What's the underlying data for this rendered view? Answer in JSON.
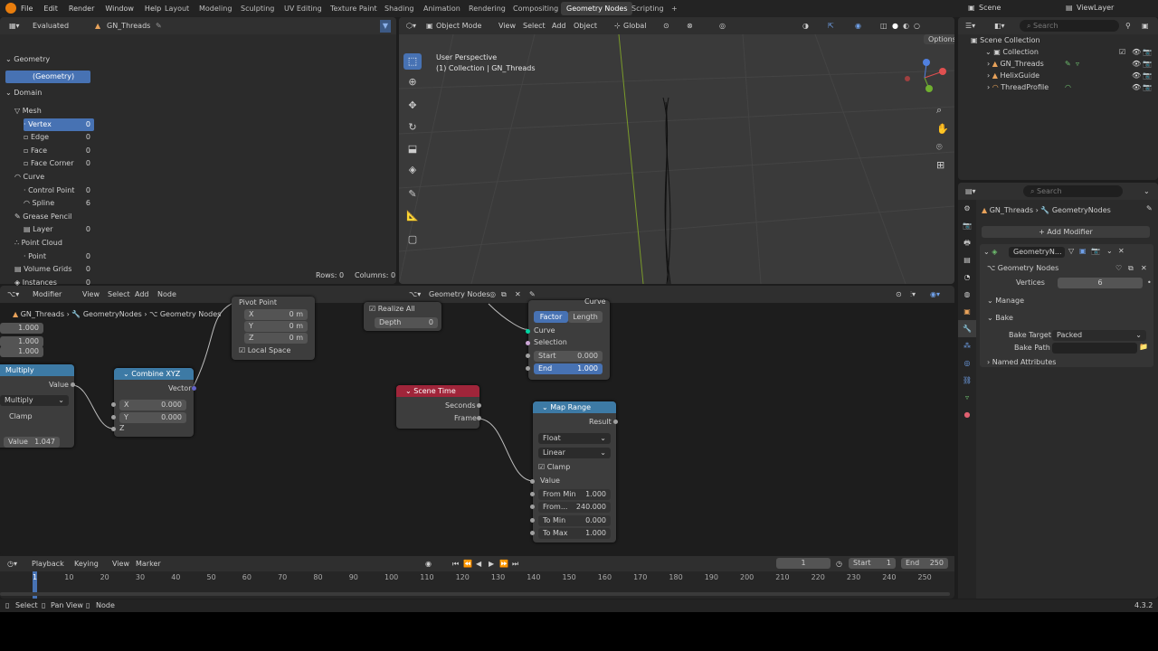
{
  "menu": [
    "File",
    "Edit",
    "Render",
    "Window",
    "Help"
  ],
  "workspaces": [
    "Layout",
    "Modeling",
    "Sculpting",
    "UV Editing",
    "Texture Paint",
    "Shading",
    "Animation",
    "Rendering",
    "Compositing",
    "Geometry Nodes",
    "Scripting"
  ],
  "scene": "Scene",
  "view_layer": "ViewLayer",
  "search_placeholder": "Search",
  "spreadsheet": {
    "mode": "Evaluated",
    "object": "GN_Threads",
    "geometry_header": "Geometry",
    "geometry_item": "(Geometry)",
    "domain_header": "Domain",
    "items": [
      {
        "label": "Mesh",
        "count": ""
      },
      {
        "label": "Vertex",
        "count": "0"
      },
      {
        "label": "Edge",
        "count": "0"
      },
      {
        "label": "Face",
        "count": "0"
      },
      {
        "label": "Face Corner",
        "count": "0"
      },
      {
        "label": "Curve",
        "count": ""
      },
      {
        "label": "Control Point",
        "count": "0"
      },
      {
        "label": "Spline",
        "count": "6"
      },
      {
        "label": "Grease Pencil",
        "count": ""
      },
      {
        "label": "Layer",
        "count": "0"
      },
      {
        "label": "Point Cloud",
        "count": ""
      },
      {
        "label": "Point",
        "count": "0"
      },
      {
        "label": "Volume Grids",
        "count": "0"
      },
      {
        "label": "Instances",
        "count": "0"
      }
    ],
    "rows": "Rows: 0",
    "columns": "Columns: 0"
  },
  "viewport": {
    "mode": "Object Mode",
    "menus": [
      "View",
      "Select",
      "Add",
      "Object"
    ],
    "orientation": "Global",
    "options": "Options",
    "perspective": "User Perspective",
    "collection": "(1) Collection | GN_Threads"
  },
  "outliner": {
    "root": "Scene Collection",
    "collection": "Collection",
    "objects": [
      "GN_Threads",
      "HelixGuide",
      "ThreadProfile"
    ]
  },
  "properties": {
    "crumb1": "GN_Threads",
    "crumb2": "GeometryNodes",
    "add_modifier": "Add Modifier",
    "modifier_name": "GeometryN...",
    "tree": "Geometry Nodes",
    "vertices_label": "Vertices",
    "vertices_value": "6",
    "manage": "Manage",
    "bake": "Bake",
    "bake_target_label": "Bake Target",
    "bake_target": "Packed",
    "bake_path_label": "Bake Path",
    "named_attributes": "Named Attributes"
  },
  "node_editor": {
    "type": "Modifier",
    "menus": [
      "View",
      "Select",
      "Add",
      "Node"
    ],
    "tree_name": "Geometry Nodes",
    "crumbs": [
      "GN_Threads",
      "GeometryNodes",
      "Geometry Nodes"
    ],
    "values_top": [
      "1.000",
      "1.000",
      "1.000"
    ],
    "multiply": {
      "title": "Multiply",
      "value": "Value",
      "op": "Multiply",
      "clamp": "Clamp",
      "value_label": "Value",
      "value_num": "1.047"
    },
    "combine": {
      "title": "Combine XYZ",
      "vector": "Vector",
      "x": "X",
      "xv": "0.000",
      "y": "Y",
      "yv": "0.000",
      "z": "Z"
    },
    "transform": {
      "pivot": "Pivot Point",
      "x": "X",
      "xv": "0 m",
      "y": "Y",
      "yv": "0 m",
      "z": "Z",
      "zv": "0 m",
      "local": "Local Space"
    },
    "realize": {
      "label": "Realize All",
      "depth": "Depth",
      "depth_v": "0"
    },
    "curve": {
      "top": "Curve",
      "factor": "Factor",
      "length": "Length",
      "curve": "Curve",
      "selection": "Selection",
      "start": "Start",
      "start_v": "0.000",
      "end": "End",
      "end_v": "1.000"
    },
    "scene_time": {
      "title": "Scene Time",
      "seconds": "Seconds",
      "frame": "Frame"
    },
    "map_range": {
      "title": "Map Range",
      "result": "Result",
      "type": "Float",
      "interp": "Linear",
      "clamp": "Clamp",
      "value": "Value",
      "from_min": "From Min",
      "from_min_v": "1.000",
      "from_max": "From...",
      "from_max_v": "240.000",
      "to_min": "To Min",
      "to_min_v": "0.000",
      "to_max": "To Max",
      "to_max_v": "1.000"
    }
  },
  "timeline": {
    "menus": [
      "Playback",
      "Keying",
      "View",
      "Marker"
    ],
    "current": "1",
    "start_label": "Start",
    "start": "1",
    "end_label": "End",
    "end": "250",
    "ticks": [
      "1",
      "10",
      "20",
      "30",
      "40",
      "50",
      "60",
      "70",
      "80",
      "90",
      "100",
      "110",
      "120",
      "130",
      "140",
      "150",
      "160",
      "170",
      "180",
      "190",
      "200",
      "210",
      "220",
      "230",
      "240",
      "250"
    ]
  },
  "status": {
    "select": "Select",
    "pan": "Pan View",
    "node": "Node",
    "version": "4.3.2"
  }
}
